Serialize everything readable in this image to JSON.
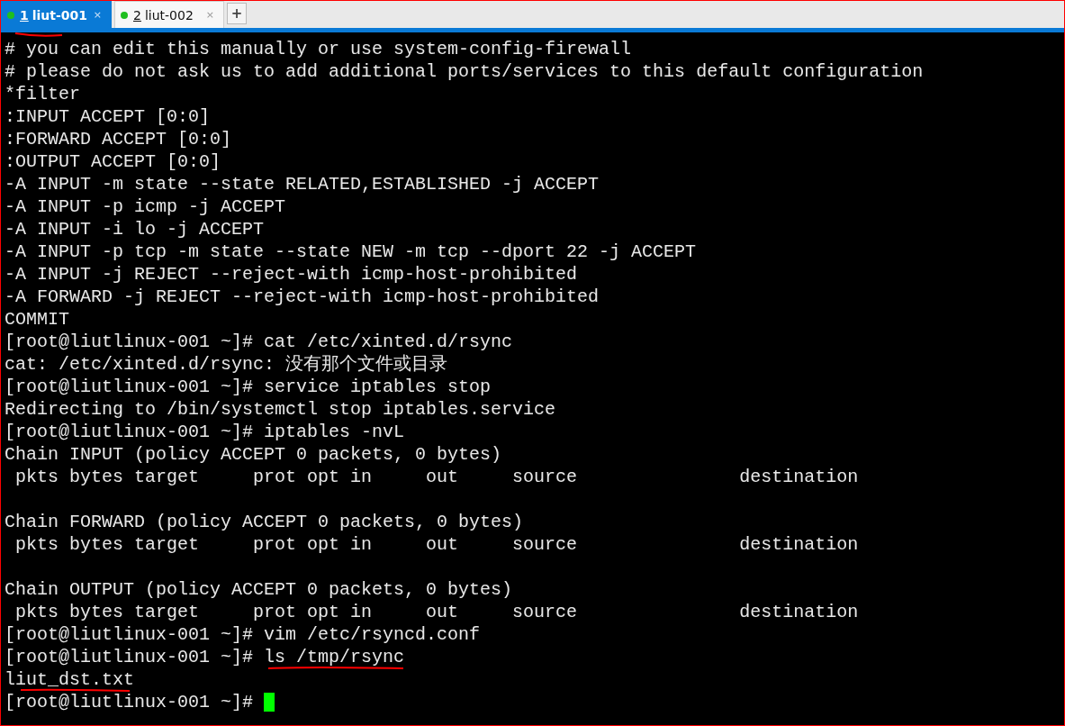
{
  "tabs": [
    {
      "number": "1",
      "label": "liut-001",
      "close": "×",
      "selected": true,
      "connected": true
    },
    {
      "number": "2",
      "label": "liut-002",
      "close": "×",
      "selected": false,
      "connected": true
    }
  ],
  "new_tab": "+",
  "terminal": {
    "lines": [
      {
        "kind": "text",
        "text": "# you can edit this manually or use system-config-firewall"
      },
      {
        "kind": "text",
        "text": "# please do not ask us to add additional ports/services to this default configuration"
      },
      {
        "kind": "text",
        "text": "*filter"
      },
      {
        "kind": "text",
        "text": ":INPUT ACCEPT [0:0]"
      },
      {
        "kind": "text",
        "text": ":FORWARD ACCEPT [0:0]"
      },
      {
        "kind": "text",
        "text": ":OUTPUT ACCEPT [0:0]"
      },
      {
        "kind": "text",
        "text": "-A INPUT -m state --state RELATED,ESTABLISHED -j ACCEPT"
      },
      {
        "kind": "text",
        "text": "-A INPUT -p icmp -j ACCEPT"
      },
      {
        "kind": "text",
        "text": "-A INPUT -i lo -j ACCEPT"
      },
      {
        "kind": "text",
        "text": "-A INPUT -p tcp -m state --state NEW -m tcp --dport 22 -j ACCEPT"
      },
      {
        "kind": "text",
        "text": "-A INPUT -j REJECT --reject-with icmp-host-prohibited"
      },
      {
        "kind": "text",
        "text": "-A FORWARD -j REJECT --reject-with icmp-host-prohibited"
      },
      {
        "kind": "text",
        "text": "COMMIT"
      },
      {
        "kind": "text",
        "text": "[root@liutlinux-001 ~]# cat /etc/xinted.d/rsync"
      },
      {
        "kind": "text",
        "text": "cat: /etc/xinted.d/rsync: 没有那个文件或目录"
      },
      {
        "kind": "text",
        "text": "[root@liutlinux-001 ~]# service iptables stop"
      },
      {
        "kind": "text",
        "text": "Redirecting to /bin/systemctl stop iptables.service"
      },
      {
        "kind": "text",
        "text": "[root@liutlinux-001 ~]# iptables -nvL"
      },
      {
        "kind": "text",
        "text": "Chain INPUT (policy ACCEPT 0 packets, 0 bytes)"
      },
      {
        "kind": "text",
        "text": " pkts bytes target     prot opt in     out     source               destination"
      },
      {
        "kind": "blank"
      },
      {
        "kind": "text",
        "text": "Chain FORWARD (policy ACCEPT 0 packets, 0 bytes)"
      },
      {
        "kind": "text",
        "text": " pkts bytes target     prot opt in     out     source               destination"
      },
      {
        "kind": "blank"
      },
      {
        "kind": "text",
        "text": "Chain OUTPUT (policy ACCEPT 0 packets, 0 bytes)"
      },
      {
        "kind": "text",
        "text": " pkts bytes target     prot opt in     out     source               destination"
      },
      {
        "kind": "text",
        "text": "[root@liutlinux-001 ~]# vim /etc/rsyncd.conf"
      },
      {
        "kind": "text",
        "text": "[root@liutlinux-001 ~]# ls /tmp/rsync"
      },
      {
        "kind": "text",
        "text": "liut_dst.txt"
      },
      {
        "kind": "prompt",
        "text": "[root@liutlinux-001 ~]# ",
        "cursor": true
      }
    ]
  }
}
